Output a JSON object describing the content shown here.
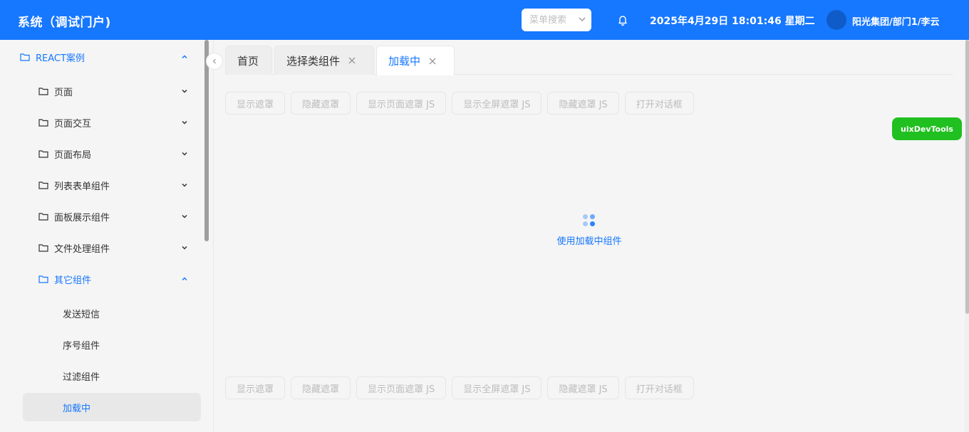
{
  "header": {
    "title": "系统（调试门户)",
    "menu_search_placeholder": "菜单搜索",
    "datetime": "2025年4月29日 18:01:46 星期二",
    "user": "阳光集团/部门1/李云"
  },
  "sidebar": {
    "items": [
      {
        "label": "REACT案例",
        "expanded": true
      },
      {
        "label": "页面",
        "expanded": false
      },
      {
        "label": "页面交互",
        "expanded": false
      },
      {
        "label": "页面布局",
        "expanded": false
      },
      {
        "label": "列表表单组件",
        "expanded": false
      },
      {
        "label": "面板展示组件",
        "expanded": false
      },
      {
        "label": "文件处理组件",
        "expanded": false
      },
      {
        "label": "其它组件",
        "expanded": true
      }
    ],
    "sub_items": [
      {
        "label": "发送短信"
      },
      {
        "label": "序号组件"
      },
      {
        "label": "过滤组件"
      },
      {
        "label": "加载中",
        "selected": true
      }
    ]
  },
  "tabs": [
    {
      "label": "首页",
      "closable": false
    },
    {
      "label": "选择类组件",
      "closable": true
    },
    {
      "label": "加载中",
      "closable": true,
      "active": true
    }
  ],
  "buttons": [
    "显示遮罩",
    "隐藏遮罩",
    "显示页面遮罩 JS",
    "显示全屏遮罩 JS",
    "隐藏遮罩 JS",
    "打开对话框"
  ],
  "loading_tip": "使用加载中组件",
  "devtools_label": "uixDevTools",
  "colors": {
    "primary": "#1677ff",
    "devtools": "#20c020"
  }
}
